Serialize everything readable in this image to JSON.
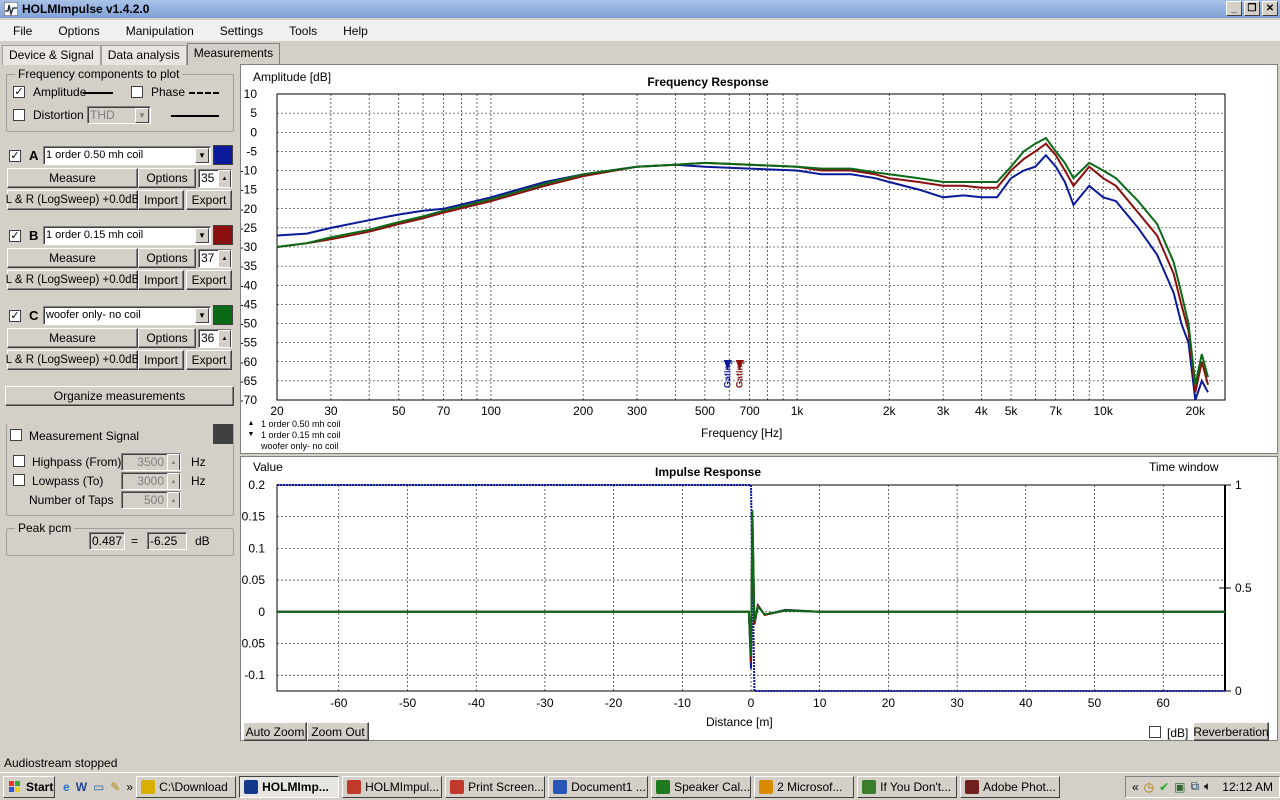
{
  "window": {
    "title": "HOLMImpulse  v1.4.2.0"
  },
  "menu": [
    "File",
    "Options",
    "Manipulation",
    "Settings",
    "Tools",
    "Help"
  ],
  "tabs": [
    "Device & Signal",
    "Data analysis",
    "Measurements"
  ],
  "freq_components": {
    "title": "Frequency components to plot",
    "amplitude": "Amplitude",
    "phase": "Phase",
    "distortion": "Distortion",
    "distortion_select": "THD"
  },
  "measurements": [
    {
      "letter": "A",
      "name": "1 order 0.50 mh coil",
      "color": "#0a1a9a",
      "count": "35",
      "measure": "Measure",
      "options": "Options",
      "info": "L & R (LogSweep) +0.0dB",
      "import": "Import",
      "export": "Export"
    },
    {
      "letter": "B",
      "name": "1 order 0.15 mh coil",
      "color": "#8a0f0f",
      "count": "37",
      "measure": "Measure",
      "options": "Options",
      "info": "L & R (LogSweep) +0.0dB",
      "import": "Import",
      "export": "Export"
    },
    {
      "letter": "C",
      "name": "woofer only- no coil",
      "color": "#0a6a16",
      "count": "36",
      "measure": "Measure",
      "options": "Options",
      "info": "L & R (LogSweep) +0.0dB",
      "import": "Import",
      "export": "Export"
    }
  ],
  "organize": "Organize measurements",
  "signal": {
    "title": "Measurement Signal",
    "highpass": "Highpass (From)",
    "highpass_val": "3500",
    "hz1": "Hz",
    "lowpass": "Lowpass (To)",
    "lowpass_val": "3000",
    "hz2": "Hz",
    "taps": "Number of Taps",
    "taps_val": "500"
  },
  "peak": {
    "title": "Peak pcm",
    "value": "0.487",
    "eq": "=",
    "db": "-6.25",
    "unit": "dB"
  },
  "freq_chart_labels": {
    "title": "Frequency Response",
    "ylabel": "Amplitude [dB]",
    "xlabel": "Frequency [Hz]",
    "legend": [
      "1 order 0.50 mh coil",
      "1 order 0.15 mh coil",
      "woofer only- no coil"
    ],
    "gating": "Gating"
  },
  "imp_chart_labels": {
    "title": "Impulse Response",
    "ylabel": "Value",
    "xlabel": "Distance [m]",
    "window": "Time window"
  },
  "bottom_buttons": {
    "auto_zoom": "Auto Zoom",
    "zoom_out": "Zoom Out",
    "db": "[dB]",
    "reverb": "Reverberation"
  },
  "status": "Audiostream stopped",
  "taskbar": {
    "start": "Start",
    "items": [
      "C:\\Download",
      "HOLMImp...",
      "HOLMImpul...",
      "Print Screen...",
      "Document1 ...",
      "Speaker Cal...",
      "2 Microsof...",
      "If You Don't...",
      "Adobe Phot..."
    ],
    "clock": "12:12 AM"
  },
  "chart_data": [
    {
      "type": "line",
      "title": "Frequency Response",
      "xlabel": "Frequency [Hz]",
      "ylabel": "Amplitude [dB]",
      "xscale": "log",
      "xlim": [
        20,
        25000
      ],
      "ylim": [
        -70,
        10
      ],
      "x_ticks": [
        "20",
        "30",
        "50",
        "70",
        "100",
        "200",
        "300",
        "500",
        "700",
        "1k",
        "2k",
        "3k",
        "4k",
        "5k",
        "7k",
        "10k",
        "20k"
      ],
      "y_ticks": [
        10,
        5,
        0,
        -5,
        -10,
        -15,
        -20,
        -25,
        -30,
        -35,
        -40,
        -45,
        -50,
        -55,
        -60,
        -65,
        -70
      ],
      "grid": true,
      "series": [
        {
          "name": "1 order 0.50 mh coil",
          "color": "#0a1a9a",
          "x": [
            20,
            25,
            30,
            40,
            50,
            60,
            70,
            100,
            150,
            200,
            300,
            400,
            500,
            700,
            1000,
            1200,
            1500,
            1800,
            2000,
            2500,
            3000,
            3500,
            4000,
            4500,
            5000,
            5500,
            6000,
            6500,
            7000,
            7500,
            8000,
            9000,
            10000,
            11000,
            13000,
            15000,
            17000,
            18000,
            19000,
            20000,
            21000,
            22000
          ],
          "y": [
            -27,
            -26.5,
            -25,
            -23,
            -21.5,
            -20.5,
            -20,
            -17,
            -13,
            -11,
            -9,
            -8.5,
            -9,
            -9.5,
            -10,
            -11,
            -11,
            -12,
            -13,
            -15,
            -17,
            -16.5,
            -17,
            -17,
            -12,
            -10,
            -9,
            -6,
            -9,
            -13,
            -19,
            -14,
            -17,
            -18,
            -25,
            -32,
            -42,
            -50,
            -55,
            -70,
            -65,
            -68
          ]
        },
        {
          "name": "1 order 0.15 mh coil",
          "color": "#8a0f0f",
          "x": [
            20,
            25,
            30,
            40,
            50,
            60,
            70,
            100,
            150,
            200,
            300,
            400,
            500,
            700,
            1000,
            1200,
            1500,
            1800,
            2000,
            2500,
            3000,
            3500,
            4000,
            4500,
            5000,
            5500,
            6000,
            6500,
            7000,
            7500,
            8000,
            9000,
            10000,
            11000,
            13000,
            15000,
            17000,
            18000,
            19000,
            20000,
            21000,
            22000
          ],
          "y": [
            -30,
            -29,
            -28,
            -26,
            -24,
            -22.5,
            -21,
            -18,
            -14,
            -11.5,
            -9,
            -8.5,
            -8,
            -8.5,
            -9,
            -10,
            -10,
            -11,
            -12,
            -13,
            -14,
            -14,
            -14.5,
            -14.5,
            -10,
            -7,
            -5,
            -3,
            -6,
            -10,
            -14,
            -9,
            -12,
            -14,
            -21,
            -27,
            -37,
            -45,
            -52,
            -68,
            -60,
            -66
          ]
        },
        {
          "name": "woofer only- no coil",
          "color": "#0a6a16",
          "x": [
            20,
            25,
            30,
            40,
            50,
            60,
            70,
            100,
            150,
            200,
            300,
            400,
            500,
            700,
            1000,
            1200,
            1500,
            1800,
            2000,
            2500,
            3000,
            3500,
            4000,
            4500,
            5000,
            5500,
            6000,
            6500,
            7000,
            7500,
            8000,
            9000,
            10000,
            11000,
            13000,
            15000,
            17000,
            18000,
            19000,
            20000,
            21000,
            22000
          ],
          "y": [
            -30,
            -29,
            -27.5,
            -25.5,
            -23.5,
            -22,
            -20.5,
            -17.5,
            -13.5,
            -11,
            -9,
            -8.5,
            -8,
            -8.5,
            -9,
            -9.5,
            -9.5,
            -10.5,
            -11,
            -12,
            -13,
            -13,
            -13,
            -13,
            -9,
            -5,
            -3,
            -1.5,
            -5,
            -8,
            -12,
            -8,
            -10,
            -12,
            -18,
            -24,
            -34,
            -42,
            -50,
            -66,
            -58,
            -64
          ]
        }
      ]
    },
    {
      "type": "line",
      "title": "Impulse Response",
      "xlabel": "Distance [m]",
      "ylabel": "Value",
      "xlim": [
        -69,
        69
      ],
      "ylim": [
        -0.125,
        0.2
      ],
      "x_ticks": [
        -60,
        -50,
        -40,
        -30,
        -20,
        -10,
        0,
        10,
        20,
        30,
        40,
        50,
        60
      ],
      "y_ticks": [
        0.2,
        0.15,
        0.1,
        0.05,
        0,
        -0.05,
        -0.1
      ],
      "y2_ticks": [
        1,
        0.5,
        0
      ],
      "y2_label": "Time window",
      "grid": true,
      "series": [
        {
          "name": "1 order 0.50 mh coil",
          "color": "#0a1a9a",
          "x": [
            -69,
            -0.3,
            0,
            0.2,
            0.5,
            1,
            2,
            5,
            10,
            20,
            69
          ],
          "y": [
            0,
            0,
            -0.09,
            0.14,
            -0.02,
            0.01,
            -0.005,
            0.003,
            0,
            0,
            0
          ]
        },
        {
          "name": "1 order 0.15 mh coil",
          "color": "#8a0f0f",
          "x": [
            -69,
            -0.3,
            0,
            0.2,
            0.5,
            1,
            2,
            5,
            10,
            20,
            69
          ],
          "y": [
            0,
            0,
            -0.08,
            0.15,
            -0.02,
            0.01,
            -0.005,
            0.002,
            0,
            0,
            0
          ]
        },
        {
          "name": "woofer only- no coil",
          "color": "#0a6a16",
          "x": [
            -69,
            -0.3,
            0,
            0.2,
            0.5,
            1,
            2,
            5,
            10,
            20,
            69
          ],
          "y": [
            0,
            0,
            -0.07,
            0.16,
            -0.015,
            0.008,
            -0.004,
            0.002,
            0,
            0,
            0
          ]
        }
      ],
      "time_window": {
        "x": [
          -69,
          0,
          0.5,
          69
        ],
        "y": [
          1,
          1,
          0,
          0
        ]
      }
    }
  ]
}
